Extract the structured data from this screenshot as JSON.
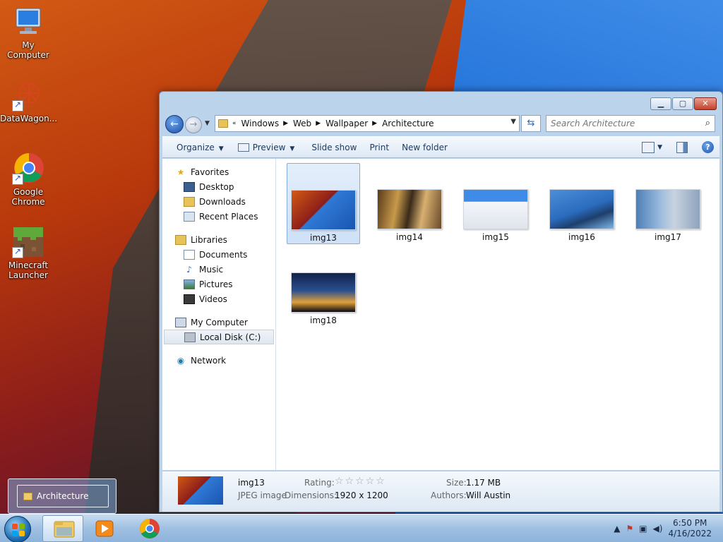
{
  "desktop": {
    "icons": [
      {
        "label": "My Computer"
      },
      {
        "label": "DataWagon..."
      },
      {
        "label": "Google Chrome"
      },
      {
        "label": "Minecraft Launcher"
      }
    ]
  },
  "window": {
    "breadcrumbs": [
      "Windows",
      "Web",
      "Wallpaper",
      "Architecture"
    ],
    "search_placeholder": "Search Architecture",
    "toolbar": {
      "organize": "Organize",
      "preview": "Preview",
      "slideshow": "Slide show",
      "print": "Print",
      "new_folder": "New folder"
    },
    "nav": {
      "favorites": "Favorites",
      "desktop": "Desktop",
      "downloads": "Downloads",
      "recent": "Recent Places",
      "libraries": "Libraries",
      "documents": "Documents",
      "music": "Music",
      "pictures": "Pictures",
      "videos": "Videos",
      "computer": "My Computer",
      "local_disk": "Local Disk (C:)",
      "network": "Network"
    },
    "files": [
      {
        "name": "img13"
      },
      {
        "name": "img14"
      },
      {
        "name": "img15"
      },
      {
        "name": "img16"
      },
      {
        "name": "img17"
      },
      {
        "name": "img18"
      }
    ],
    "details": {
      "name": "img13",
      "type": "JPEG image",
      "rating_label": "Rating:",
      "rating_stars": "☆☆☆☆☆",
      "dimensions_label": "Dimensions:",
      "dimensions": "1920 x 1200",
      "size_label": "Size:",
      "size": "1.17 MB",
      "authors_label": "Authors:",
      "authors": "Will Austin"
    }
  },
  "taskbar": {
    "preview_title": "Architecture",
    "time": "6:50 PM",
    "date": "4/16/2022"
  }
}
